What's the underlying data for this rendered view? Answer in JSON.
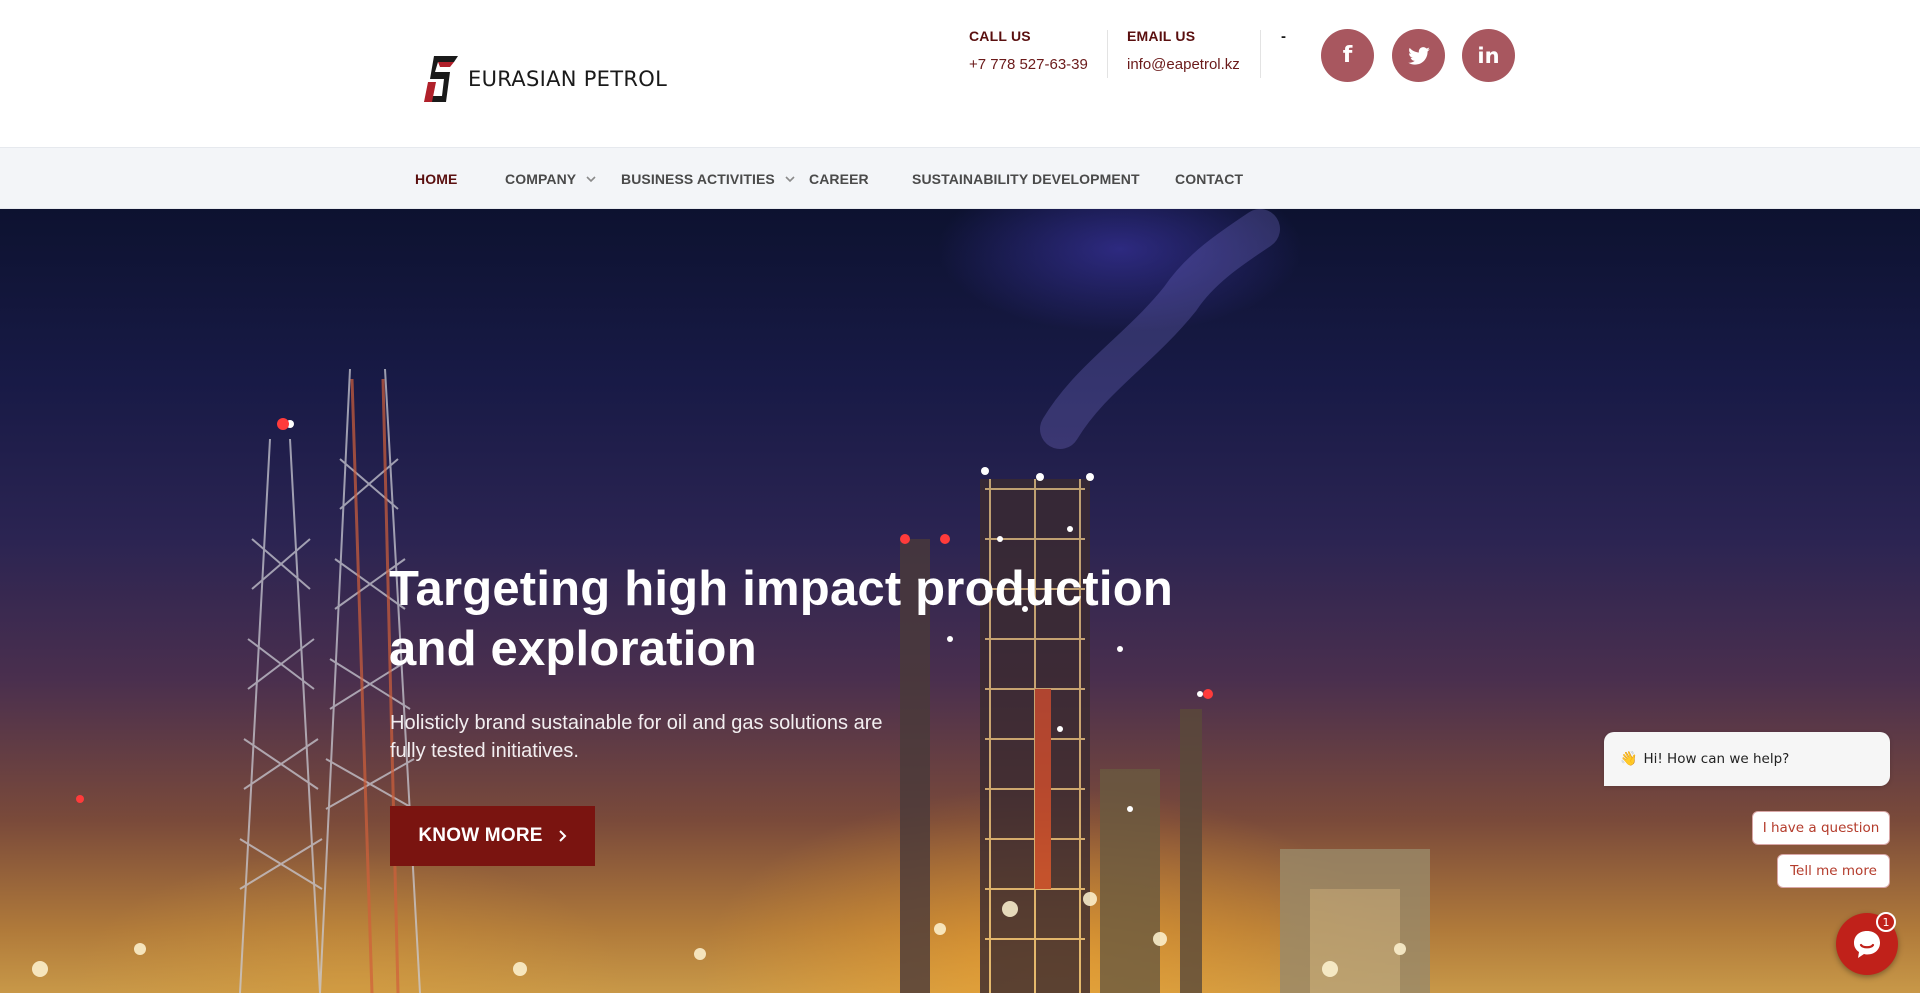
{
  "header": {
    "logo_text": "EURASIAN PETROL",
    "call": {
      "label": "CALL US",
      "value": "+7 778 527-63-39"
    },
    "email": {
      "label": "EMAIL US",
      "value": "info@eapetrol.kz"
    },
    "separator_text": "-",
    "social": [
      {
        "icon": "facebook-icon",
        "glyph": "f"
      },
      {
        "icon": "twitter-icon",
        "glyph": ""
      },
      {
        "icon": "linkedin-icon",
        "glyph": "in"
      }
    ]
  },
  "nav": {
    "items": [
      {
        "label": "HOME",
        "active": true,
        "dropdown": false
      },
      {
        "label": "COMPANY",
        "active": false,
        "dropdown": true
      },
      {
        "label": "BUSINESS ACTIVITIES",
        "active": false,
        "dropdown": true
      },
      {
        "label": "CAREER",
        "active": false,
        "dropdown": false
      },
      {
        "label": "SUSTAINABILITY DEVELOPMENT",
        "active": false,
        "dropdown": false
      },
      {
        "label": "CONTACT",
        "active": false,
        "dropdown": false
      }
    ]
  },
  "hero": {
    "title": "Targeting high impact production and exploration",
    "subtitle": "Holisticly brand sustainable for oil and gas solutions are fully tested initiatives.",
    "button_label": "KNOW MORE"
  },
  "chat": {
    "greeting_emoji": "👋",
    "greeting": "Hi! How can we help?",
    "options": [
      "I have a question",
      "Tell me more"
    ],
    "badge_count": "1"
  },
  "colors": {
    "brand": "#5a0f0f",
    "button": "#7a1410",
    "social_bg": "#a8575f",
    "nav_bg": "#f3f5f8",
    "chat_red": "#c0211a"
  }
}
